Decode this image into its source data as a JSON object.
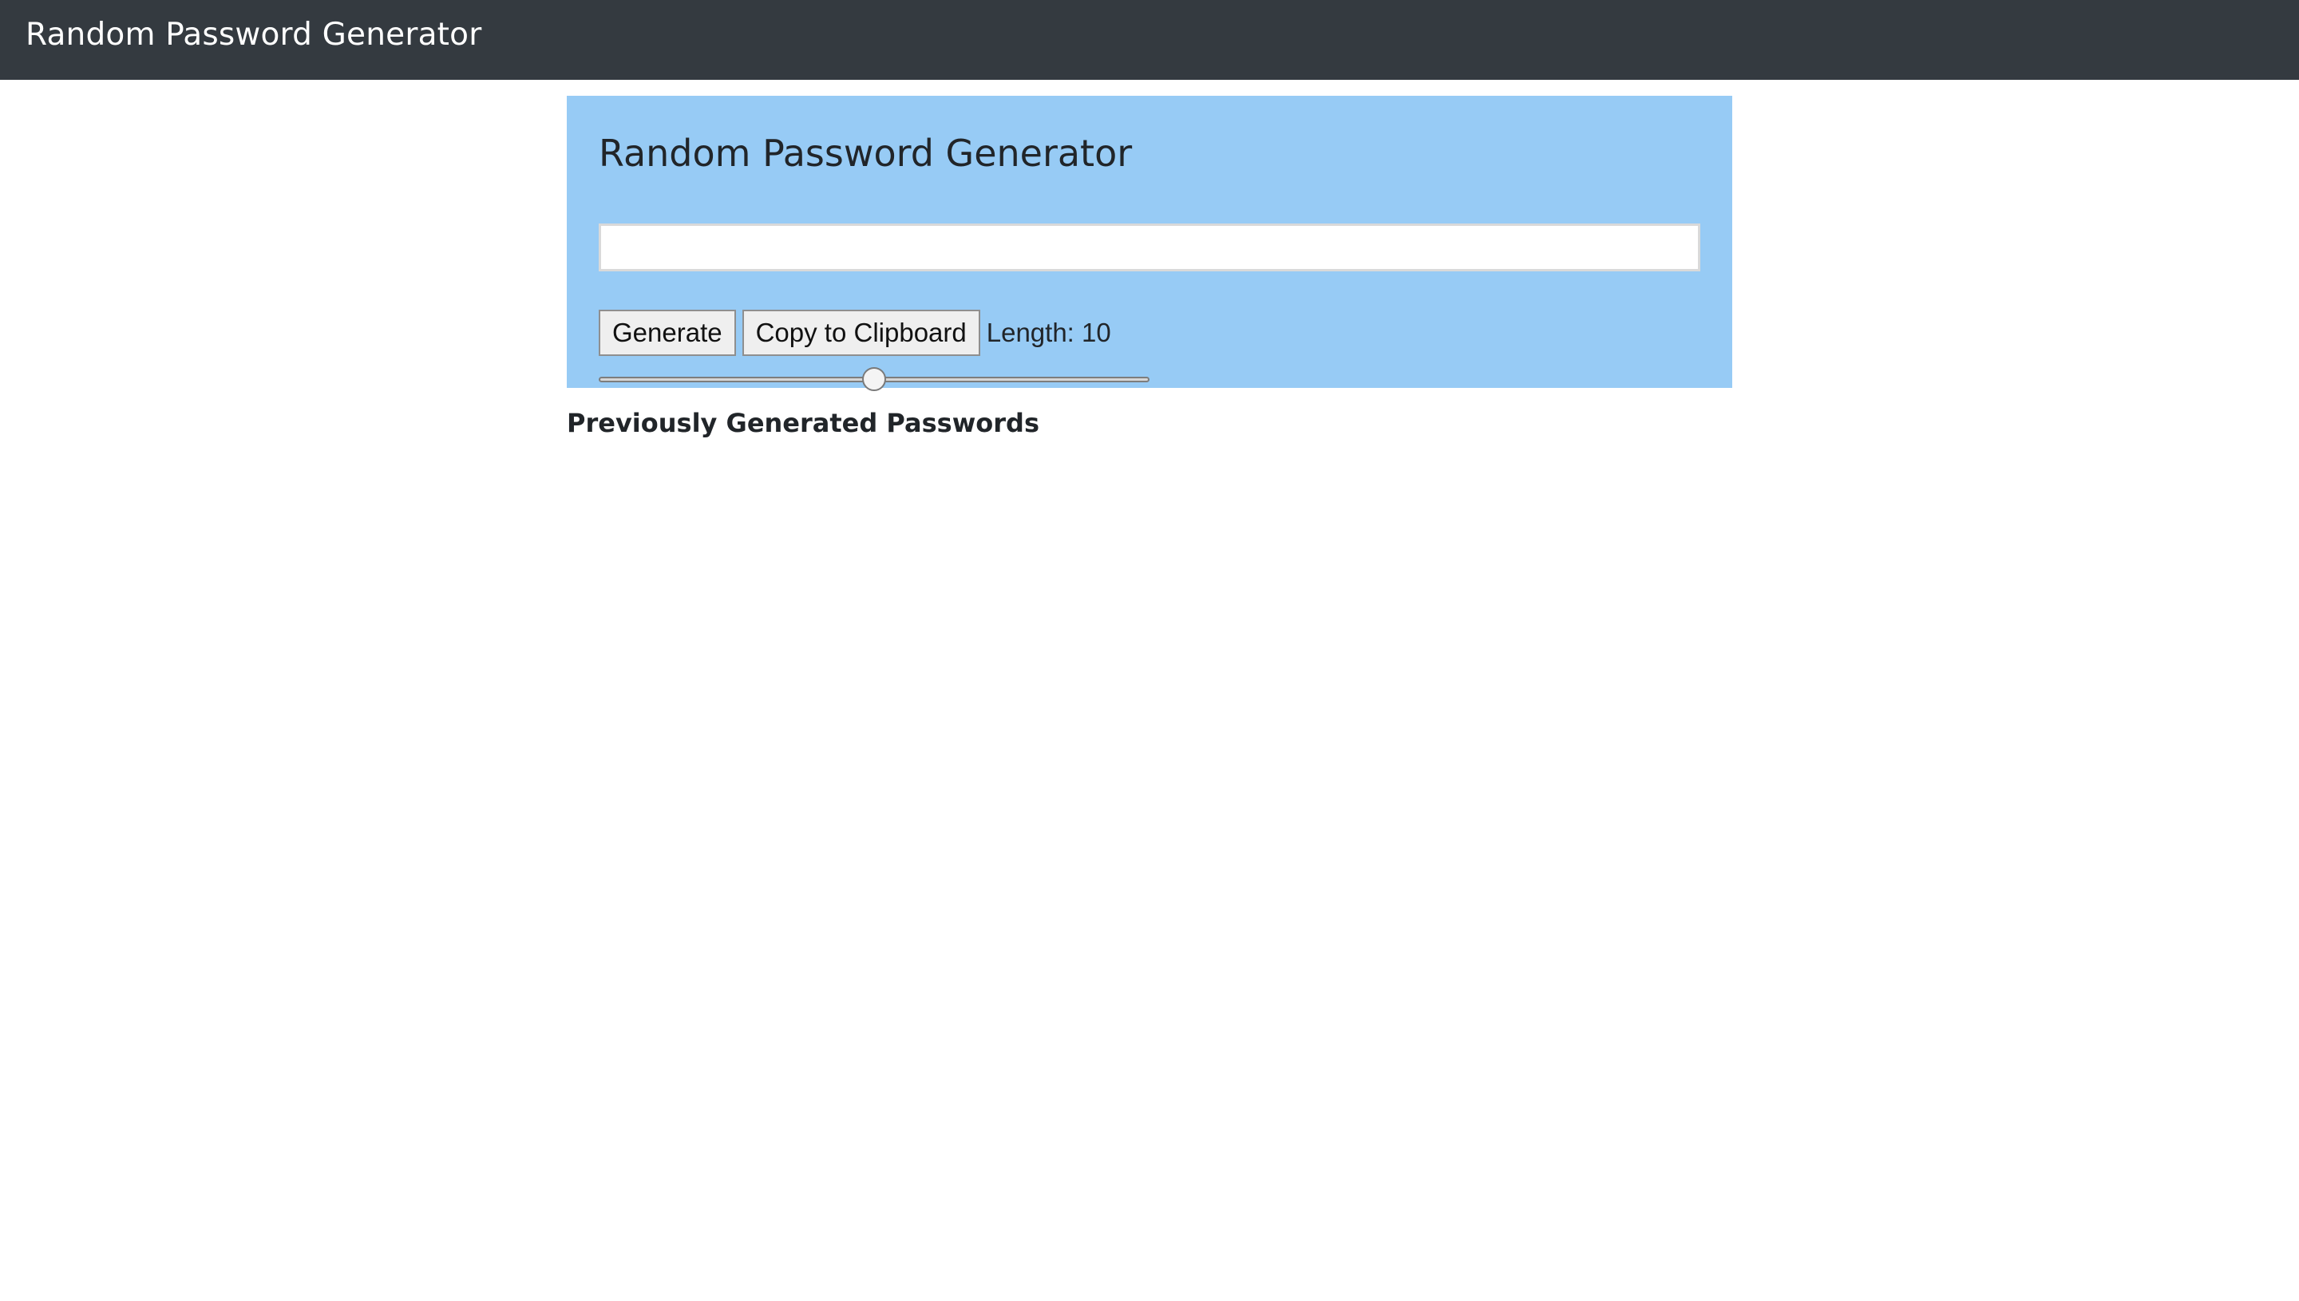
{
  "navbar": {
    "brand": "Random Password Generator"
  },
  "generator": {
    "title": "Random Password Generator",
    "password_value": "",
    "slider": {
      "value_fraction": 0.5
    },
    "generate_label": "Generate",
    "copy_label": "Copy to Clipboard",
    "length_label": "Length: 10"
  },
  "history": {
    "heading": "Previously Generated Passwords",
    "items": []
  },
  "colors": {
    "navbar_bg": "#343a40",
    "panel_bg": "#97cbf5"
  }
}
